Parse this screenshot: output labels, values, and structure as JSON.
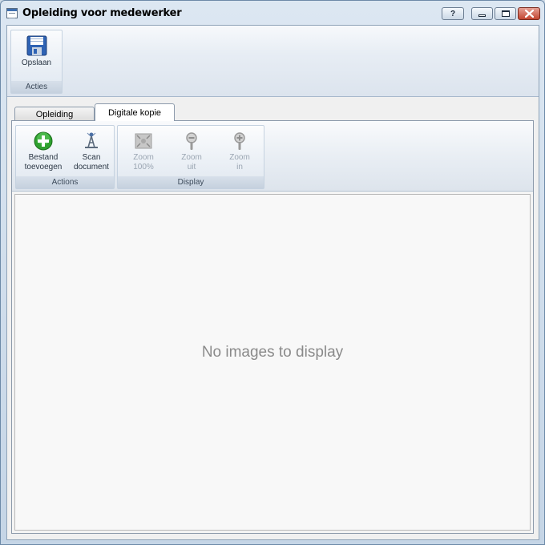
{
  "window": {
    "title": "Opleiding voor medewerker",
    "buttons": {
      "help": "?"
    }
  },
  "ribbon": {
    "groups": [
      {
        "label": "Acties",
        "buttons": [
          {
            "label": "Opslaan",
            "icon": "save-icon"
          }
        ]
      }
    ]
  },
  "tabs": [
    {
      "label": "Opleiding",
      "active": false
    },
    {
      "label": "Digitale kopie",
      "active": true
    }
  ],
  "panel_ribbon": {
    "groups": [
      {
        "label": "Actions",
        "buttons": [
          {
            "line1": "Bestand",
            "line2": "toevoegen",
            "icon": "add-icon",
            "enabled": true
          },
          {
            "line1": "Scan",
            "line2": "document",
            "icon": "scanner-icon",
            "enabled": true
          }
        ]
      },
      {
        "label": "Display",
        "buttons": [
          {
            "line1": "Zoom",
            "line2": "100%",
            "icon": "zoom-fit-icon",
            "enabled": false
          },
          {
            "line1": "Zoom",
            "line2": "uit",
            "icon": "zoom-out-icon",
            "enabled": false
          },
          {
            "line1": "Zoom",
            "line2": "in",
            "icon": "zoom-in-icon",
            "enabled": false
          }
        ]
      }
    ]
  },
  "viewer": {
    "empty_message": "No images to display"
  },
  "colors": {
    "add_green": "#2fa12f",
    "save_blue": "#2f63b4",
    "close_red": "#c24530"
  }
}
